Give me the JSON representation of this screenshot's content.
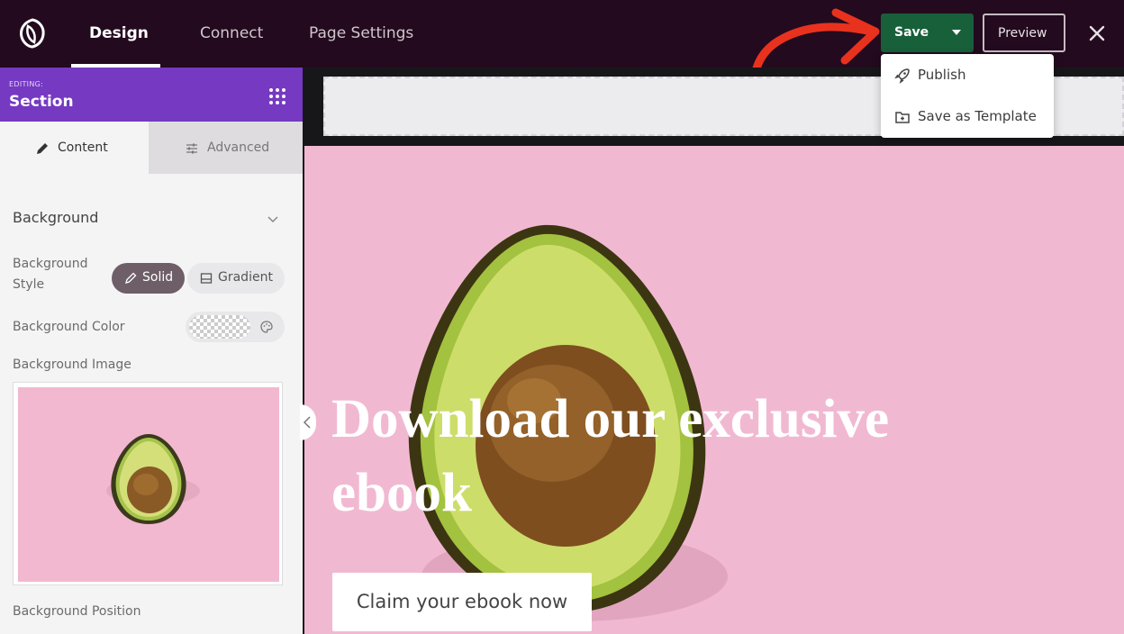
{
  "topbar": {
    "nav": {
      "design": "Design",
      "connect": "Connect",
      "page_settings": "Page Settings"
    },
    "save_label": "Save",
    "preview_label": "Preview"
  },
  "dropdown": {
    "publish": "Publish",
    "save_template": "Save as Template"
  },
  "sidebar": {
    "editing_label": "EDITING:",
    "section_title": "Section",
    "tabs": {
      "content": "Content",
      "advanced": "Advanced"
    },
    "background_heading": "Background",
    "bg_style_label": "Background Style",
    "style_options": {
      "solid": "Solid",
      "gradient": "Gradient"
    },
    "bg_color_label": "Background Color",
    "bg_image_label": "Background Image",
    "bg_position_label": "Background Position"
  },
  "canvas": {
    "headline": "Download our exclusive ebook",
    "cta": "Claim your ebook now"
  },
  "colors": {
    "topbar": "#230a1e",
    "save_button": "#17603a",
    "sidebar_header": "#7539c2",
    "hero_background": "#f1b9d1",
    "annotation_arrow": "#e8321e"
  }
}
